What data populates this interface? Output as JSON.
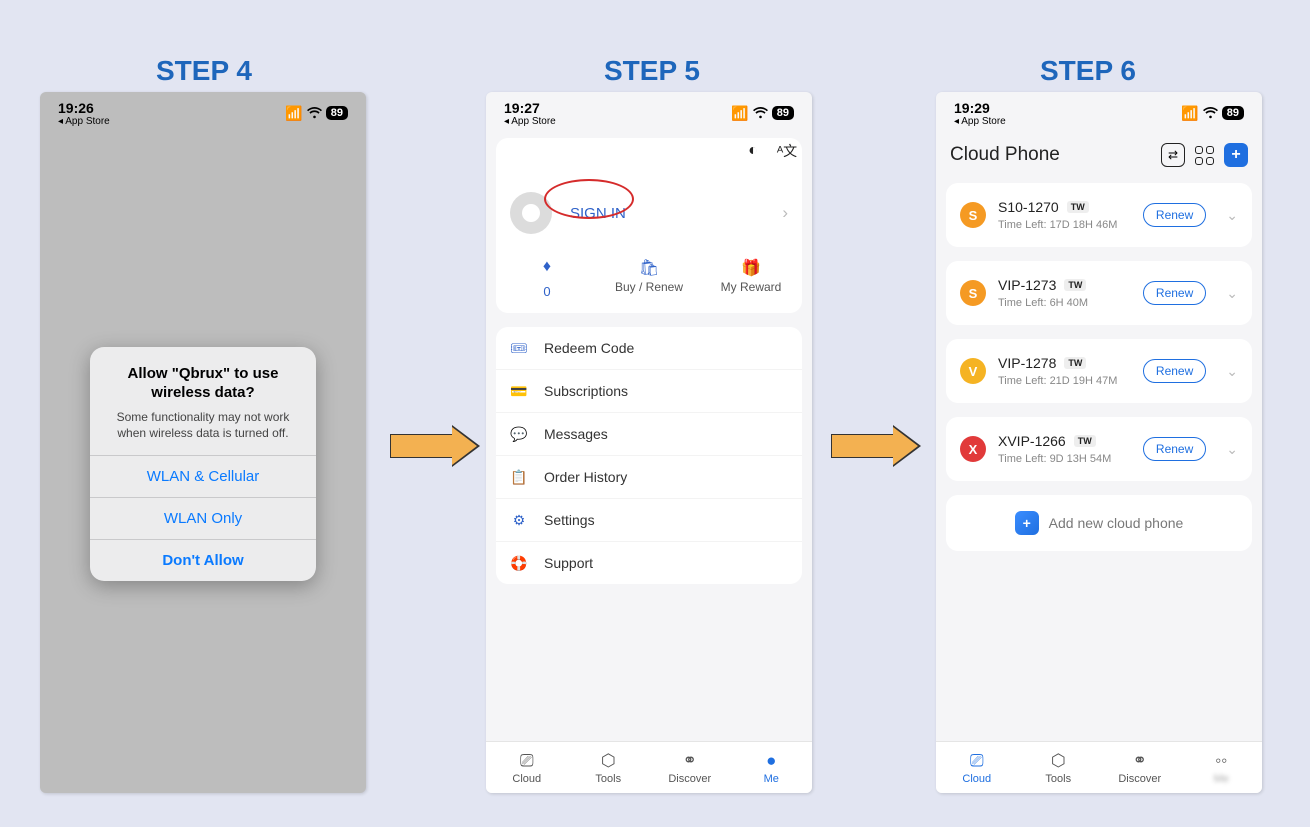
{
  "steps": {
    "s4": "STEP 4",
    "s5": "STEP 5",
    "s6": "STEP 6"
  },
  "status": {
    "t4": "19:26",
    "t5": "19:27",
    "t6": "19:29",
    "back": "◂ App Store",
    "battery": "89"
  },
  "dialog": {
    "title1": "Allow \"Qbrux\" to use",
    "title2": "wireless data?",
    "sub": "Some functionality may not work when wireless data is turned off.",
    "opt1": "WLAN & Cellular",
    "opt2": "WLAN Only",
    "opt3": "Don't Allow"
  },
  "panel5": {
    "signin": "SIGN IN",
    "diamond": "0",
    "buy": "Buy / Renew",
    "reward": "My Reward",
    "menu": [
      "Redeem Code",
      "Subscriptions",
      "Messages",
      "Order History",
      "Settings",
      "Support"
    ]
  },
  "tabs": {
    "cloud": "Cloud",
    "tools": "Tools",
    "discover": "Discover",
    "me": "Me"
  },
  "panel6": {
    "title": "Cloud Phone",
    "renew": "Renew",
    "add": "Add new cloud phone",
    "timeLeftPrefix": "Time Left:  ",
    "items": [
      {
        "icon": "s",
        "name": "S10-1270",
        "tw": "TW",
        "time": "17D  18H  46M"
      },
      {
        "icon": "s",
        "name": "VIP-1273",
        "tw": "TW",
        "time": "6H  40M"
      },
      {
        "icon": "v",
        "name": "VIP-1278",
        "tw": "TW",
        "time": "21D  19H  47M"
      },
      {
        "icon": "x",
        "name": "XVIP-1266",
        "tw": "TW",
        "time": "9D  13H  54M"
      }
    ]
  }
}
